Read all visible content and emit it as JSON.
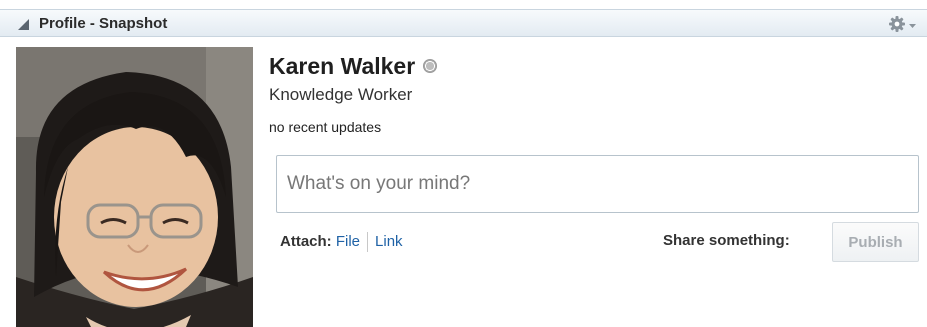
{
  "panel": {
    "title": "Profile - Snapshot",
    "collapse_icon": "collapse-triangle-icon",
    "settings_icon": "gear-icon"
  },
  "profile": {
    "name": "Karen Walker",
    "role": "Knowledge Worker",
    "status_text": "no recent updates",
    "presence": "offline",
    "photo": "user-profile-photo"
  },
  "post": {
    "placeholder": "What's on your mind?",
    "attach_label": "Attach:",
    "attach_file_label": "File",
    "attach_link_label": "Link",
    "share_label": "Share something:",
    "publish_label": "Publish"
  },
  "colors": {
    "header_bg": "#e3ebf2",
    "link": "#1f62a6",
    "publish_disabled_text": "#a8adb2"
  }
}
